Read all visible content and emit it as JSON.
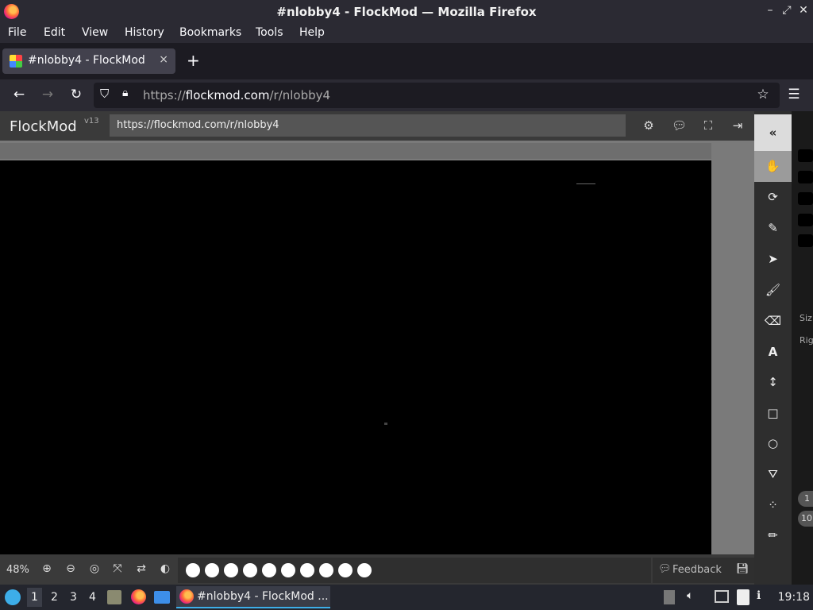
{
  "window": {
    "title": "#nlobby4 - FlockMod — Mozilla Firefox"
  },
  "menu": [
    "File",
    "Edit",
    "View",
    "History",
    "Bookmarks",
    "Tools",
    "Help"
  ],
  "tab": {
    "label": "#nlobby4 - FlockMod",
    "close": "×"
  },
  "newtab": "+",
  "address": {
    "prefix": "https://",
    "host": "flockmod.com",
    "path": "/r/nlobby4"
  },
  "app": {
    "brand": "FlockMod",
    "version": "v13",
    "room_url": "https://flockmod.com/r/nlobby4",
    "zoom": "48%",
    "feedback": "Feedback",
    "swatch_count": 10
  },
  "sidepanel": {
    "labels": [
      "Siz",
      "Rig",
      "1",
      "10"
    ]
  },
  "taskbar": {
    "workspaces": [
      "1",
      "2",
      "3",
      "4"
    ],
    "app_label": "#nlobby4 - FlockMod ...",
    "clock": "19:18"
  },
  "icons": {
    "collapse": "«",
    "hand": "✋",
    "rotate": "⟳",
    "eyedropper": "✎",
    "pointer": "➤",
    "brush": "🖌",
    "eraser": "⌫",
    "text": "A",
    "resize": "↕",
    "rect": "□",
    "circle": "○",
    "fill": "⛛",
    "lasso": "⁘",
    "pen": "✏"
  }
}
